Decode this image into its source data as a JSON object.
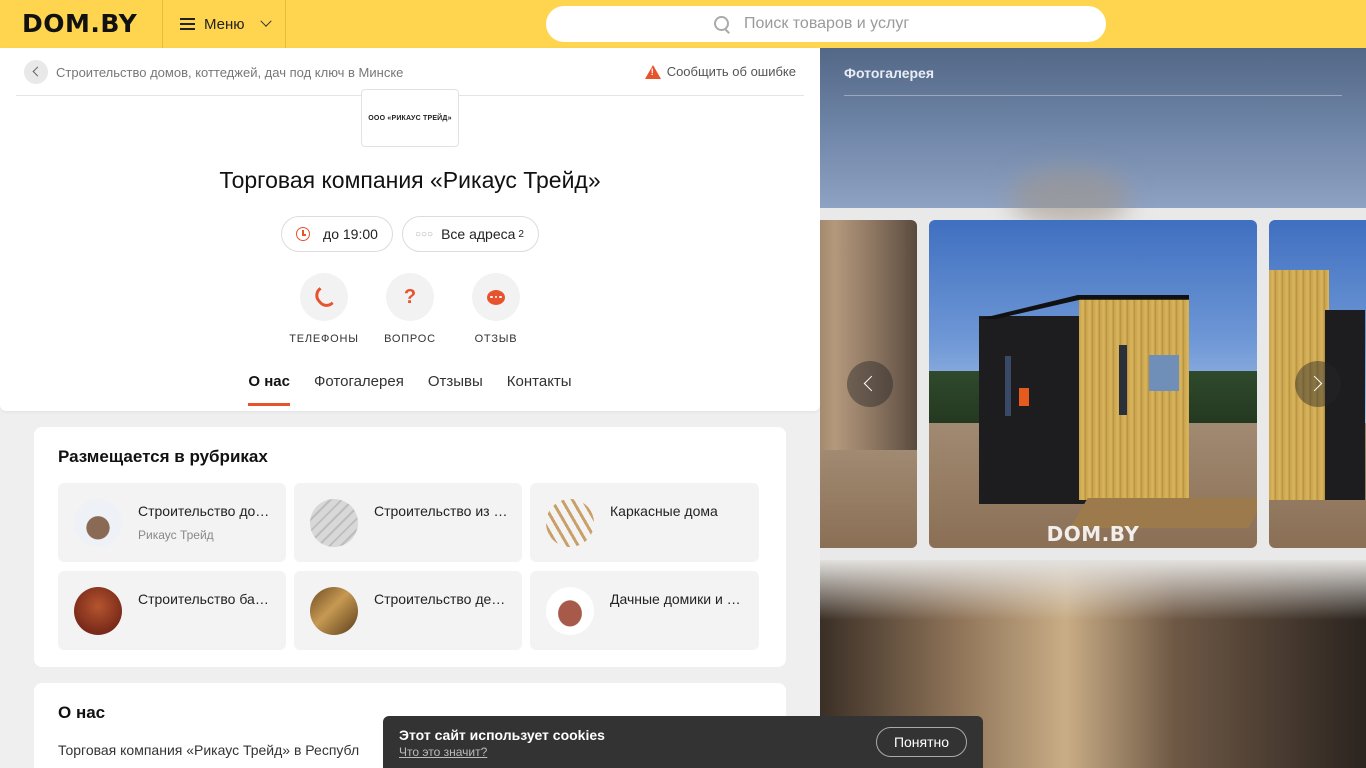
{
  "header": {
    "logo": "DOM.BY",
    "menu_label": "Меню",
    "search_placeholder": "Поиск товаров и услуг"
  },
  "breadcrumb": {
    "text": "Строительство домов, коттеджей, дач под ключ в Минске",
    "report_label": "Сообщить об ошибке"
  },
  "company": {
    "logo_text": "ООО «РИКАУС ТРЕЙД»",
    "title": "Торговая компания «Рикаус Трейд»",
    "hours": "до 19:00",
    "addresses_label": "Все адреса",
    "addresses_count": "2"
  },
  "actions": [
    {
      "label": "ТЕЛЕФОНЫ",
      "icon": "phone-icon"
    },
    {
      "label": "ВОПРОС",
      "icon": "question-icon",
      "glyph": "?"
    },
    {
      "label": "ОТЗЫВ",
      "icon": "chat-icon"
    }
  ],
  "tabs": [
    {
      "label": "О нас",
      "active": true
    },
    {
      "label": "Фотогалерея"
    },
    {
      "label": "Отзывы"
    },
    {
      "label": "Контакты"
    }
  ],
  "rubrics": {
    "title": "Размещается в рубриках",
    "items": [
      {
        "name": "Строительство домов, коттеджей, дач под ключ",
        "sub": "Рикаус Трейд"
      },
      {
        "name": "Строительство из газосиликатных блоков"
      },
      {
        "name": "Каркасные дома"
      },
      {
        "name": "Строительство бань и саун"
      },
      {
        "name": "Строительство деревянных домов"
      },
      {
        "name": "Дачные домики и бытовки"
      }
    ]
  },
  "about": {
    "title": "О нас",
    "text": "Торговая компания «Рикаус Трейд» в Республ"
  },
  "gallery": {
    "title": "Фотогалерея",
    "watermark": "DOM.BY"
  },
  "cookie": {
    "title": "Этот сайт использует cookies",
    "link": "Что это значит?",
    "button": "Понятно"
  },
  "colors": {
    "brand_yellow": "#ffd54f",
    "accent_orange": "#e6532c"
  }
}
